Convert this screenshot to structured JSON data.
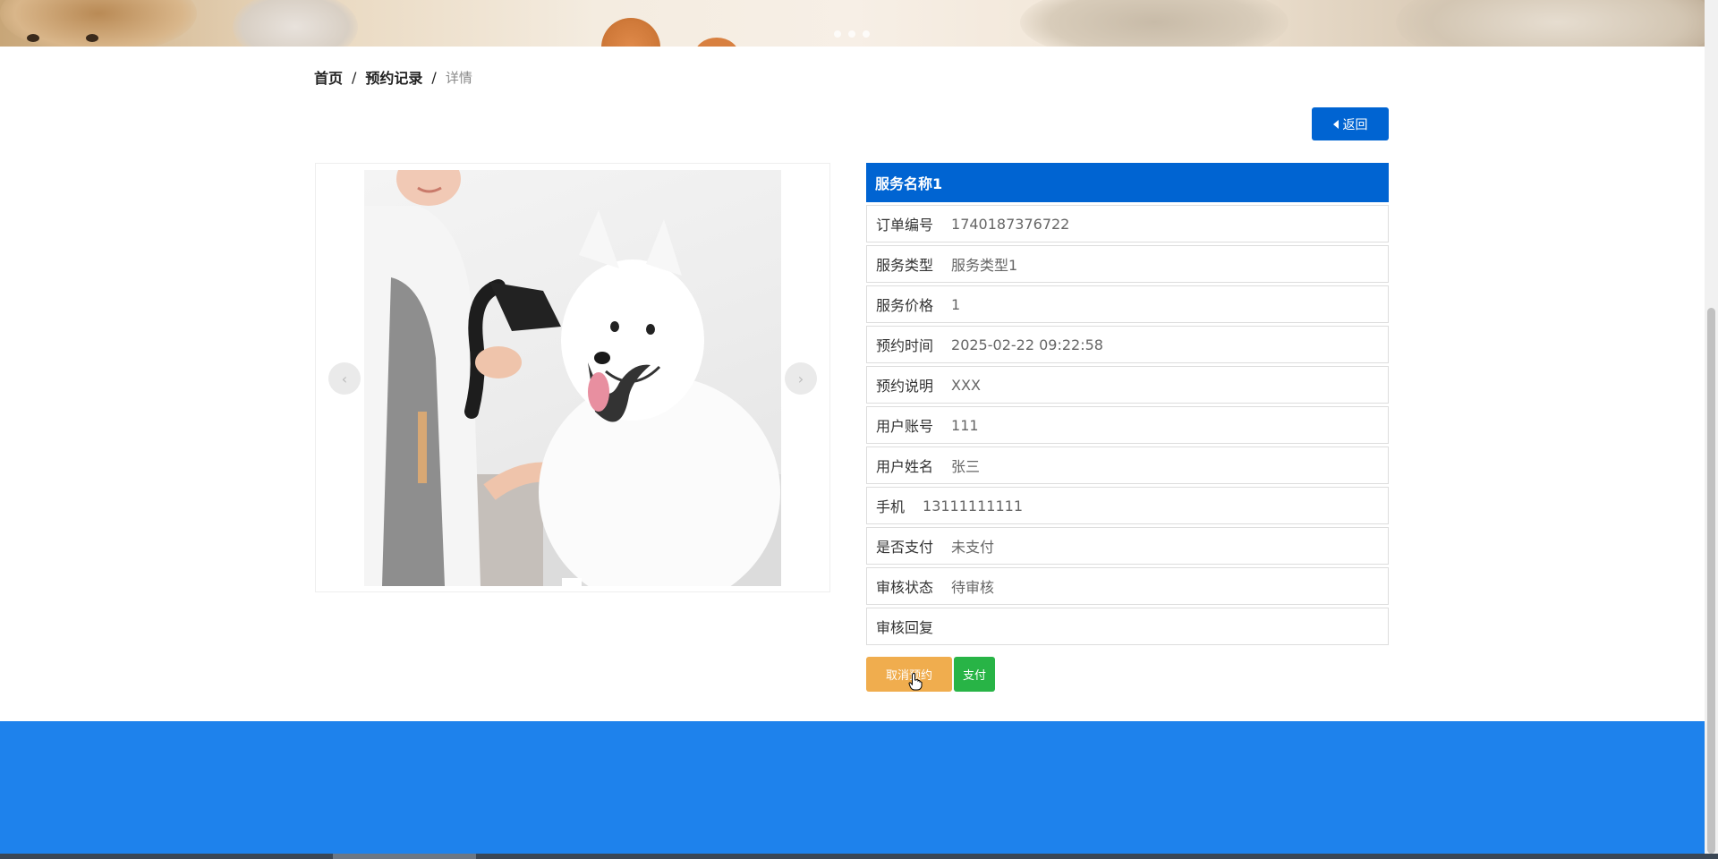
{
  "breadcrumb": {
    "home": "首页",
    "records": "预约记录",
    "current": "详情",
    "separator": "/"
  },
  "back_button": {
    "label": "返回",
    "icon": "caret-left-icon"
  },
  "carousel": {
    "prev_icon": "‹",
    "next_icon": "›",
    "banner_slide_count": 3
  },
  "detail": {
    "title": "服务名称1",
    "fields": [
      {
        "label": "订单编号",
        "value": "1740187376722"
      },
      {
        "label": "服务类型",
        "value": "服务类型1"
      },
      {
        "label": "服务价格",
        "value": "1"
      },
      {
        "label": "预约时间",
        "value": "2025-02-22 09:22:58"
      },
      {
        "label": "预约说明",
        "value": "XXX"
      },
      {
        "label": "用户账号",
        "value": "111"
      },
      {
        "label": "用户姓名",
        "value": "张三"
      },
      {
        "label": "手机",
        "value": "13111111111"
      },
      {
        "label": "是否支付",
        "value": "未支付"
      },
      {
        "label": "审核状态",
        "value": "待审核"
      },
      {
        "label": "审核回复",
        "value": ""
      }
    ]
  },
  "actions": {
    "cancel_label": "取消预约",
    "pay_label": "支付"
  },
  "colors": {
    "primary": "#0064d2",
    "warning": "#f0ad4e",
    "success": "#28b446",
    "footer": "#1e82ec"
  }
}
